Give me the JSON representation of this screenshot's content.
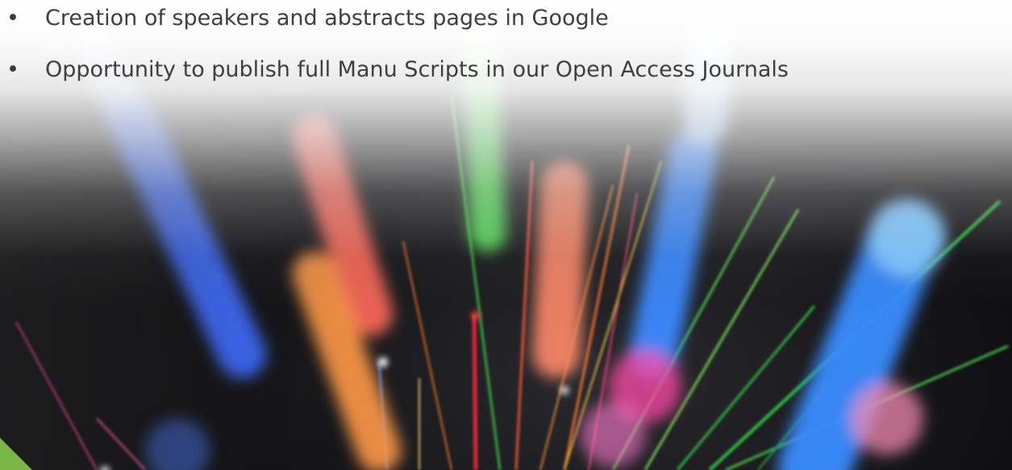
{
  "bullets": [
    {
      "marker": "•",
      "text": "Creation of speakers and abstracts pages in Google"
    },
    {
      "marker": "•",
      "text": "Opportunity to publish full Manu Scripts in our Open Access Journals"
    }
  ],
  "colors": {
    "text": "#3f3f3f",
    "accent": "#7ab648"
  }
}
